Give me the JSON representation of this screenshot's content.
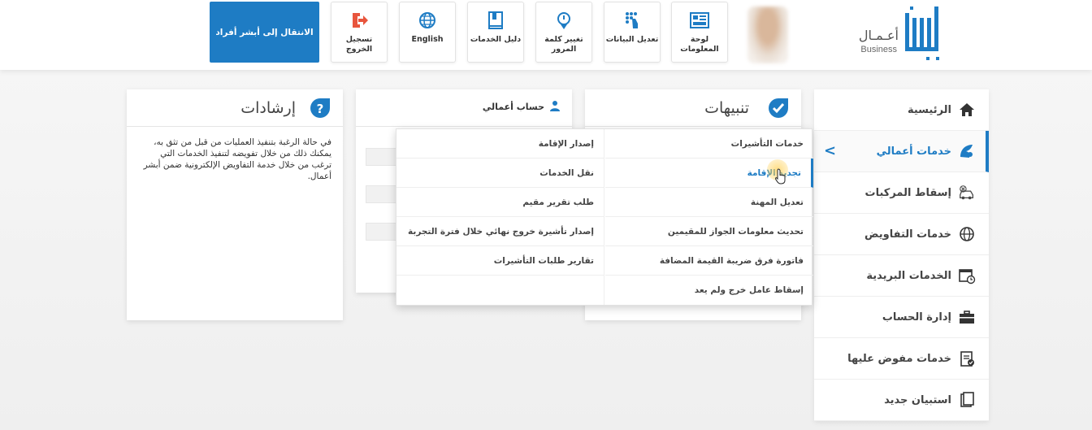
{
  "header": {
    "logo": {
      "name": "أعـمـال",
      "sub": "Business"
    },
    "tiles": [
      {
        "id": "dashboard",
        "label": "لوحة المعلومات",
        "icon": "dashboard-icon"
      },
      {
        "id": "edit-data",
        "label": "تعديل البيانات",
        "icon": "fingerprint-icon"
      },
      {
        "id": "change-password",
        "label": "تغيير كلمة المرور",
        "icon": "lock-icon"
      },
      {
        "id": "services-guide",
        "label": "دليل الخدمات",
        "icon": "book-icon"
      },
      {
        "id": "language",
        "label": "English",
        "icon": "globe-icon"
      },
      {
        "id": "logout",
        "label": "تسجيل الخروج",
        "icon": "logout-icon"
      }
    ],
    "absher_button": "الانتقال إلى أبشر أفراد"
  },
  "sidebar": {
    "items": [
      {
        "label": "الرئيسية",
        "icon": "home-icon"
      },
      {
        "label": "خدمات أعمالي",
        "icon": "services-icon",
        "active": true
      },
      {
        "label": "إسقاط المركبات",
        "icon": "car-drop-icon"
      },
      {
        "label": "خدمات التفاويض",
        "icon": "globe-icon"
      },
      {
        "label": "الخدمات البريدية",
        "icon": "calendar-icon"
      },
      {
        "label": "إدارة الحساب",
        "icon": "briefcase-icon"
      },
      {
        "label": "خدمات مفوض عليها",
        "icon": "clipboard-icon"
      },
      {
        "label": "استبيان جديد",
        "icon": "survey-icon"
      }
    ]
  },
  "panels": {
    "irshadat": {
      "title": "إرشادات",
      "text": "في حالة الرغبة بتنفيذ العمليات من قبل من تثق به، يمكنك ذلك من خلال تفويضه لتنفيذ الخدمات التي ترغب من خلال خدمة التفاويض الإلكترونية ضمن أبشر أعمال."
    },
    "hesab": {
      "title": "حساب أعمالي"
    },
    "tanbihat": {
      "title": "تنبيهات"
    }
  },
  "dropdown": {
    "right": [
      "خدمات التأشيرات",
      "تجديد الإقامة",
      "تعديل المهنة",
      "تحديث معلومات الجواز للمقيمين",
      "فاتورة فرق ضريبة القيمة المضافة",
      "إسقاط عامل خرج ولم يعد"
    ],
    "left": [
      "إصدار الإقامة",
      "نقل الخدمات",
      "طلب تقرير مقيم",
      "إصدار تأشيرة خروج نهائي خلال فترة التجربة",
      "تقارير طلبات التأشيرات"
    ]
  },
  "colors": {
    "accent": "#1e7cc4",
    "logout": "#e8553d"
  }
}
